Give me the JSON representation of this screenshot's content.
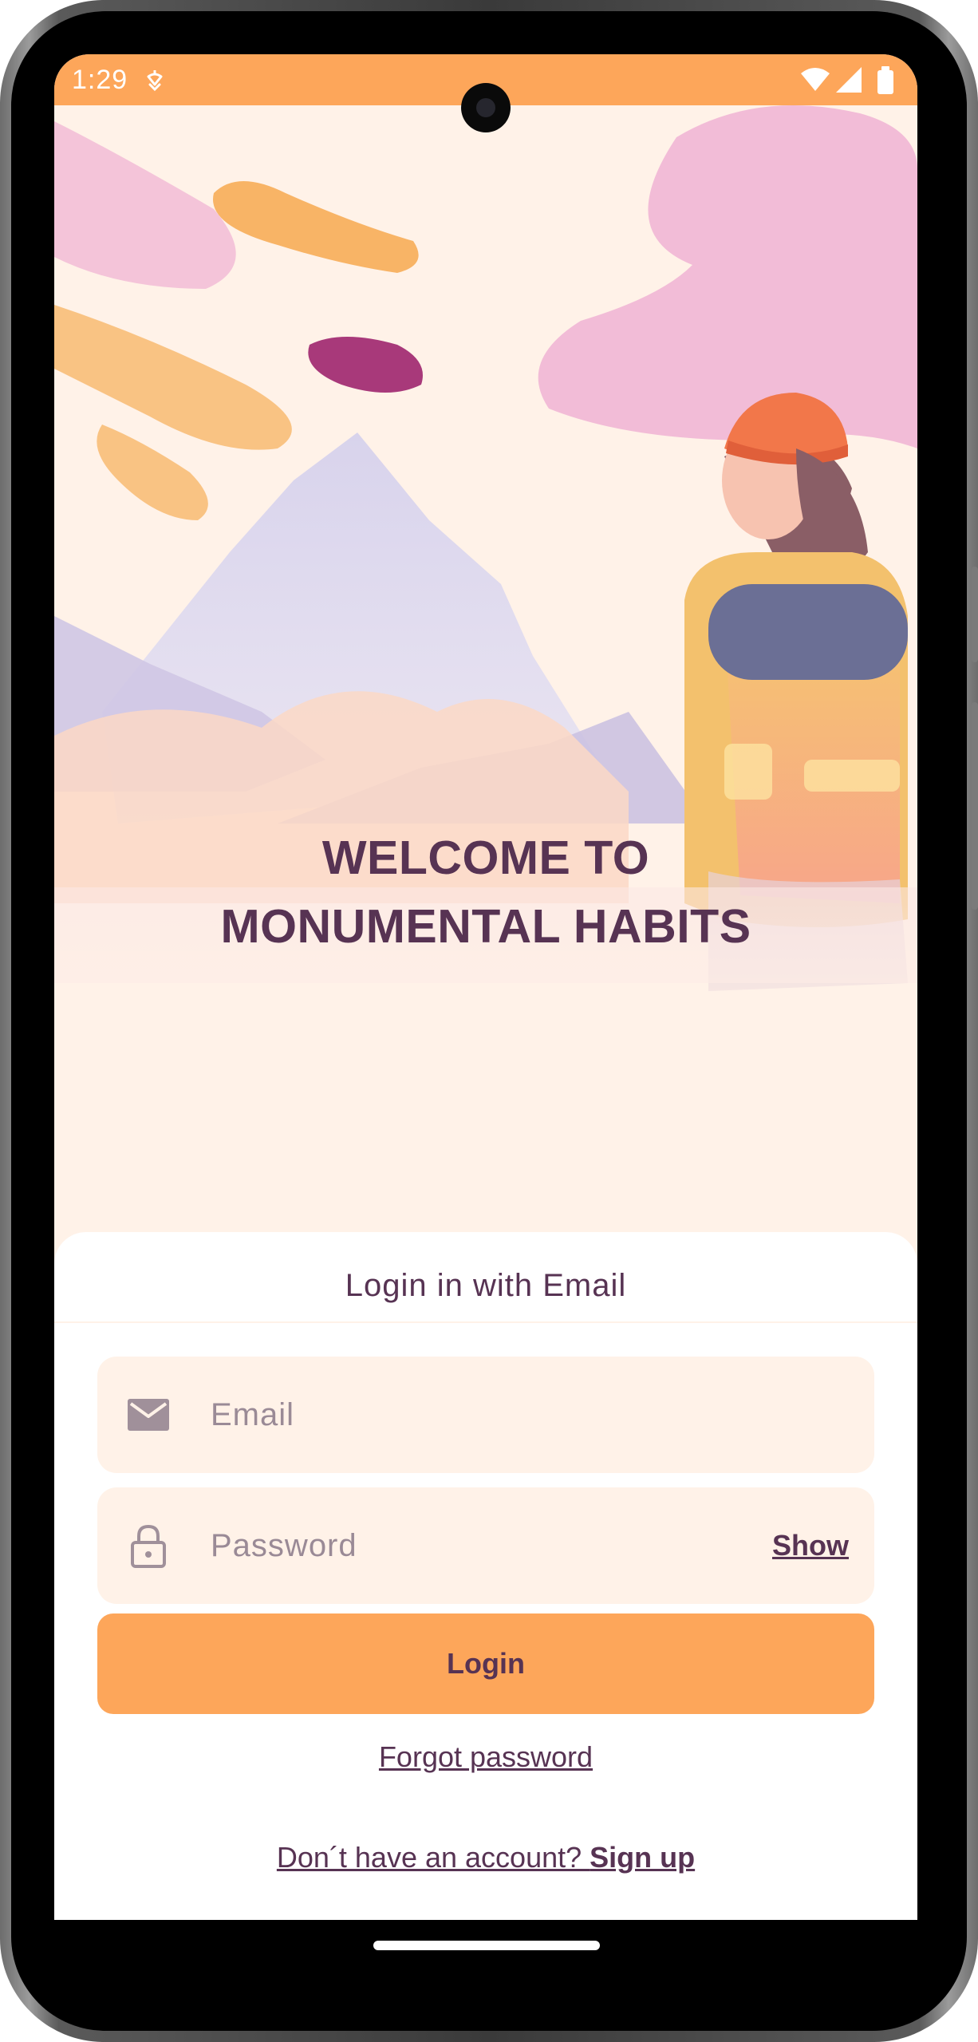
{
  "status_bar": {
    "time": "1:29",
    "icons": [
      "debug-icon",
      "wifi-icon",
      "signal-icon",
      "battery-icon"
    ]
  },
  "hero": {
    "title_line1": "WELCOME TO",
    "title_line2": "MONUMENTAL HABITS"
  },
  "login": {
    "header": "Login in with Email",
    "email_placeholder": "Email",
    "password_placeholder": "Password",
    "show_label": "Show",
    "login_label": "Login",
    "forgot_label": "Forgot password",
    "signup_prompt": "Don´t have an account?",
    "signup_label": "Sign up"
  },
  "colors": {
    "primary": "#FDA65A",
    "background": "#FFF2E8",
    "text": "#573353",
    "surface": "#FFFFFF"
  }
}
